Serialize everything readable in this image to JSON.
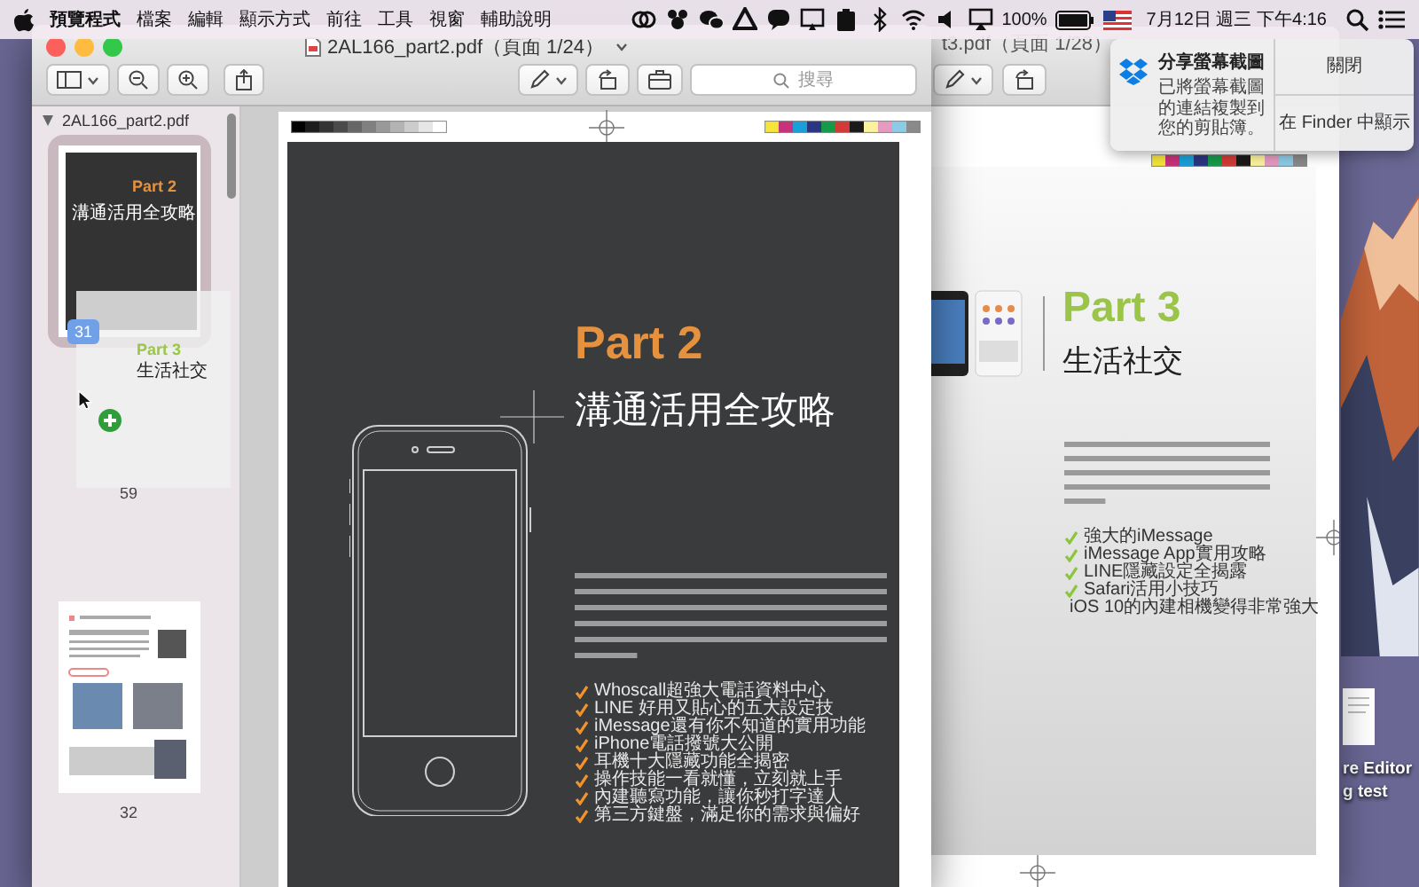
{
  "menubar": {
    "app": "預覽程式",
    "menus": [
      "檔案",
      "編輯",
      "顯示方式",
      "前往",
      "工具",
      "視窗",
      "輔助說明"
    ],
    "battery": "100%",
    "clock": "7月12日 週三 下午4:16"
  },
  "back_window": {
    "title": "t3.pdf（頁面 1/28）",
    "page": {
      "heading": "Part 3",
      "subtitle": "生活社交",
      "checklist": [
        "強大的iMessage",
        "iMessage App實用攻略",
        "LINE隱藏設定全揭露",
        "Safari活用小技巧",
        "iOS 10的內建相機變得非常強大"
      ]
    }
  },
  "front_window": {
    "title": "2AL166_part2.pdf（頁面 1/24）",
    "search": {
      "placeholder": "搜尋"
    },
    "sidebar": {
      "file": "2AL166_part2.pdf",
      "expanded": true,
      "thumbnails": [
        {
          "kind": "cover",
          "label": "59",
          "selected": true,
          "heading": "Part 2",
          "subtitle": "溝通活用全攻略"
        },
        {
          "kind": "article",
          "label": "32",
          "selected": false
        }
      ],
      "drag": {
        "badge": "31",
        "heading": "Part 3",
        "subtitle": "生活社交"
      }
    },
    "page": {
      "heading": "Part 2",
      "subtitle": "溝通活用全攻略",
      "checklist": [
        "Whoscall超強大電話資料中心",
        "LINE 好用又貼心的五大設定技",
        "iMessage還有你不知道的實用功能",
        "iPhone電話撥號大公開",
        "耳機十大隱藏功能全揭密",
        "操作技能一看就懂，立刻就上手",
        "內建聽寫功能，讓你秒打字達人",
        "第三方鍵盤，滿足你的需求與偏好"
      ]
    }
  },
  "notification": {
    "title": "分享螢幕截圖",
    "body": "已將螢幕截圖的連結複製到您的剪貼簿。",
    "buttons": [
      "關閉",
      "在 Finder 中顯示"
    ]
  },
  "desktop_labels": [
    "re Editor",
    "g test"
  ]
}
